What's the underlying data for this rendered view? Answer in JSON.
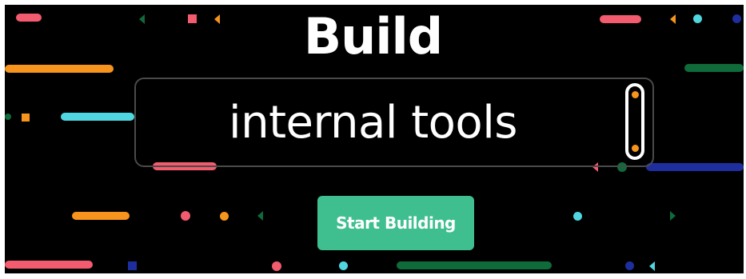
{
  "hero": {
    "title": "Build",
    "typed_phrase": "internal tools",
    "cta_label": "Start Building"
  },
  "colors": {
    "background": "#000000",
    "cta": "#3fbf8f",
    "pink": "#f35b6e",
    "orange": "#f7941d",
    "cyan": "#4fd6e0",
    "green": "#0f6b3a",
    "navy": "#1f2e9e"
  }
}
